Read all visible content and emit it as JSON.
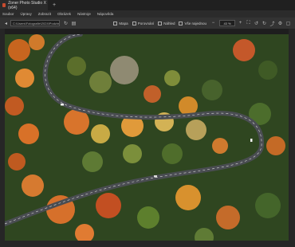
{
  "app": {
    "tab_title": "Zoner Photo Studio X (x64)",
    "new_tab_glyph": "+"
  },
  "menu": [
    "Soubor",
    "Úpravy",
    "Zobrazit",
    "Obrázek",
    "Nástroje",
    "Nápověda"
  ],
  "toolbar": {
    "path": "C:\\Users\\Fotografie\\2024\\Podzim",
    "labels": [
      "Mapa",
      "Porovnání",
      "Náhled",
      "Vše najednou"
    ],
    "zoom": "43 %",
    "icons": [
      "back-icon",
      "forward-icon",
      "up-icon",
      "refresh-icon",
      "folder-icon",
      "map-icon",
      "compare-icon",
      "preview-icon",
      "all-icon",
      "zoom-out-icon",
      "zoom-in-icon",
      "fit-icon",
      "rotate-left-icon",
      "rotate-right-icon",
      "share-icon",
      "settings-icon",
      "maximize-icon"
    ]
  },
  "photo": {
    "subject": "aerial autumn forest with winding road"
  }
}
